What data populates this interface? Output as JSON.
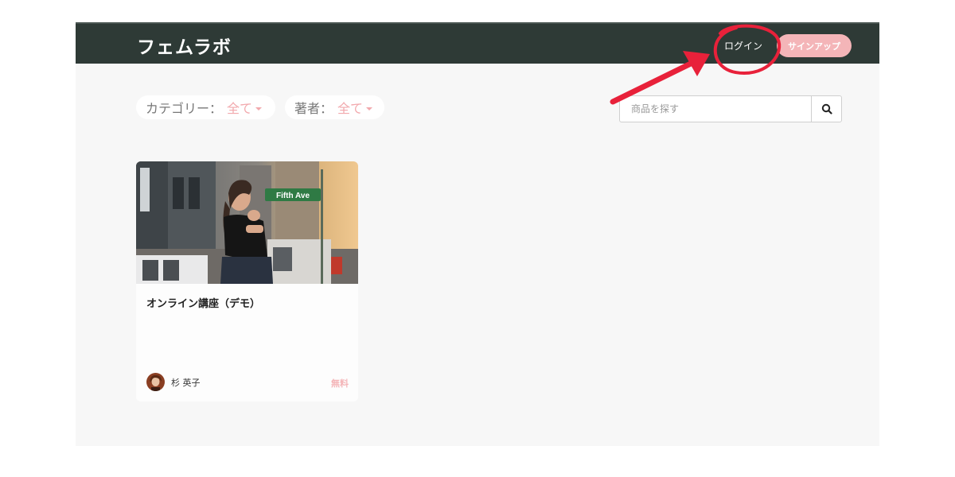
{
  "header": {
    "brand": "フェムラボ",
    "login_label": "ログイン",
    "signup_label": "サインアップ"
  },
  "filters": {
    "category_label": "カテゴリー：",
    "category_value": "全て",
    "author_label": "著者：",
    "author_value": "全て"
  },
  "search": {
    "placeholder": "商品を探す",
    "value": ""
  },
  "products": [
    {
      "title": "オンライン講座（デモ）",
      "author": "杉 英子",
      "price": "無料",
      "image_sign": "Fifth Ave"
    }
  ],
  "colors": {
    "header_bg": "#2e3a36",
    "accent_pink": "#f4b5b8",
    "annotation_red": "#e8213a"
  },
  "icons": {
    "search": "search-icon",
    "caret": "caret-down-icon"
  }
}
